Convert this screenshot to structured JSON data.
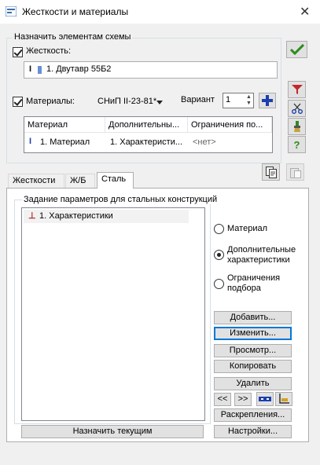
{
  "window": {
    "title": "Жесткости и материалы"
  },
  "assign": {
    "group_label": "Назначить элементам схемы",
    "stiffness_label": "Жесткость:",
    "stiffness_value": "1. Двутавр 55Б2",
    "materials_label": "Материалы:",
    "norm": "СНиП II-23-81*",
    "variant_label": "Вариант",
    "variant_value": "1",
    "table": {
      "headers": [
        "Материал",
        "Дополнительны...",
        "Ограничения по..."
      ],
      "row": [
        "1. Материал",
        "1. Характеристи...",
        "<нет>"
      ]
    }
  },
  "tabs": [
    "Жесткости",
    "Ж/Б",
    "Сталь"
  ],
  "steel": {
    "group_label": "Задание параметров для стальных конструкций",
    "items": [
      "1. Характеристики"
    ],
    "radios": [
      "Материал",
      "Дополнительные характеристики",
      "Ограничения подбора"
    ],
    "buttons": {
      "add": "Добавить...",
      "edit": "Изменить...",
      "view": "Просмотр...",
      "copy": "Копировать",
      "delete": "Удалить",
      "prev": "<<",
      "next": ">>",
      "bracing": "Раскрепления...",
      "settings": "Настройки..."
    },
    "assign_current": "Назначить текущим"
  },
  "colors": {
    "accent": "#0078d7",
    "icon_blue": "#1c3fb0",
    "apply_green": "#2e8b1e",
    "filter_red": "#c0282c"
  }
}
